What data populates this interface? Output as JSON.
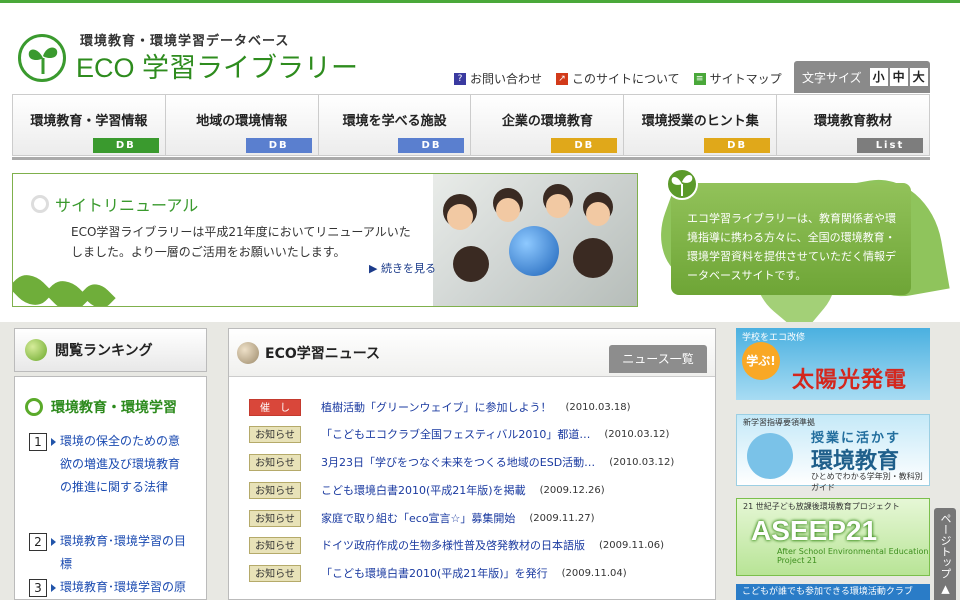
{
  "header": {
    "subtitle": "環境教育・環境学習データベース",
    "title": "ECO 学習ライブラリー",
    "util_links": [
      {
        "label": "お問い合わせ",
        "icon": "question-icon",
        "color": "#3a3aa0"
      },
      {
        "label": "このサイトについて",
        "icon": "arrow-icon",
        "color": "#d23a1a"
      },
      {
        "label": "サイトマップ",
        "icon": "sitemap-icon",
        "color": "#4aa83a"
      }
    ],
    "fontsize": {
      "label": "文字サイズ",
      "small": "小",
      "medium": "中",
      "large": "大"
    }
  },
  "nav": {
    "items": [
      {
        "label": "環境教育・学習情報",
        "tag": "DB",
        "color": "#3a9a2e"
      },
      {
        "label": "地域の環境情報",
        "tag": "DB",
        "color": "#5a7fcf"
      },
      {
        "label": "環境を学べる施設",
        "tag": "DB",
        "color": "#5a7fcf"
      },
      {
        "label": "企業の環境教育",
        "tag": "DB",
        "color": "#e0a81a"
      },
      {
        "label": "環境授業のヒント集",
        "tag": "DB",
        "color": "#e0a81a"
      },
      {
        "label": "環境教育教材",
        "tag": "List",
        "color": "#7d7d7d"
      }
    ]
  },
  "hero": {
    "title": "サイトリニューアル",
    "body": "ECO学習ライブラリーは平成21年度においてリニューアルいたしました。より一層のご活用をお願いいたします。",
    "more": "続きを見る"
  },
  "intro": {
    "text": "エコ学習ライブラリーは、教育関係者や環境指導に携わる方々に、全国の環境教育・環境学習資料を提供させていただく情報データベースサイトです。"
  },
  "ranking": {
    "title": "閲覧ランキング",
    "category": "環境教育・環境学習",
    "items": [
      {
        "num": "1",
        "text": "環境の保全のための意欲の増進及び環境教育の推進に関する法律"
      },
      {
        "num": "2",
        "text": "環境教育･環境学習の目標"
      },
      {
        "num": "3",
        "text": "環境教育･環境学習の原則"
      }
    ]
  },
  "news": {
    "title": "ECO学習ニュース",
    "list_button": "ニュース一覧",
    "items": [
      {
        "badge": "催　し",
        "type": "event",
        "text": "植樹活動「グリーンウェイブ」に参加しよう！",
        "date": "(2010.03.18)"
      },
      {
        "badge": "お知らせ",
        "type": "notice",
        "text": "「こどもエコクラブ全国フェスティバル2010」都道…",
        "date": "(2010.03.12)"
      },
      {
        "badge": "お知らせ",
        "type": "notice",
        "text": "3月23日「学びをつなぐ未来をつくる地域のESD活動…",
        "date": "(2010.03.12)"
      },
      {
        "badge": "お知らせ",
        "type": "notice",
        "text": "こども環境白書2010(平成21年版)を掲載",
        "date": "(2009.12.26)"
      },
      {
        "badge": "お知らせ",
        "type": "notice",
        "text": "家庭で取り組む「eco宣言☆」募集開始",
        "date": "(2009.11.27)"
      },
      {
        "badge": "お知らせ",
        "type": "notice",
        "text": "ドイツ政府作成の生物多様性普及啓発教材の日本語版",
        "date": "(2009.11.06)"
      },
      {
        "badge": "お知らせ",
        "type": "notice",
        "text": "「こども環境白書2010(平成21年版)」を発行",
        "date": "(2009.11.04)"
      }
    ]
  },
  "banners": {
    "solar": {
      "small": "学校をエコ改修",
      "badge": "学ぶ!",
      "main": "太陽光発電"
    },
    "edu": {
      "small": "新学習指導要領準拠",
      "top": "授業に活かす",
      "main": "環境教育",
      "sub": "ひとめでわかる学年別・教科別ガイド"
    },
    "aseep": {
      "small": "21 世紀子ども放課後環境教育プロジェクト",
      "main": "ASEEP21",
      "sub": "After School Environmental Education Project 21"
    },
    "club": {
      "text": "こどもが誰でも参加できる環境活動クラブ"
    }
  },
  "pagetop": "ページトップ ▲",
  "colors": {
    "brand": "#3a9a2e",
    "link": "#1a3aa0",
    "event_badge": "#d9473a",
    "notice_badge": "#e8e2b8"
  }
}
